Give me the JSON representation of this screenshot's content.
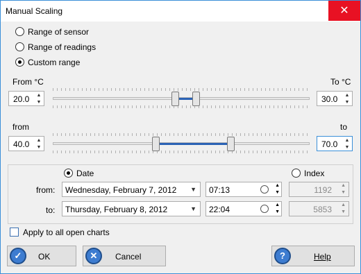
{
  "window": {
    "title": "Manual Scaling",
    "close_glyph": "✕"
  },
  "range_options": [
    {
      "label": "Range of sensor",
      "selected": false
    },
    {
      "label": "Range of readings",
      "selected": false
    },
    {
      "label": "Custom range",
      "selected": true
    }
  ],
  "temp_range": {
    "from_label": "From °C",
    "to_label": "To °C",
    "from_value": "20.0",
    "to_value": "30.0"
  },
  "reading_range": {
    "from_label": "from",
    "to_label": "to",
    "from_value": "40.0",
    "to_value": "70.0"
  },
  "selection": {
    "date_label": "Date",
    "date_selected": true,
    "index_label": "Index",
    "index_selected": false,
    "from_label": "from:",
    "to_label": "to:",
    "from_date": "Wednesday, February 7, 2012",
    "from_time": "07:13",
    "from_index": "1192",
    "to_date": "Thursday, February 8, 2012",
    "to_time": "22:04",
    "to_index": "5853"
  },
  "apply_all": {
    "label": "Apply to all open charts",
    "checked": false
  },
  "buttons": {
    "ok": "OK",
    "cancel": "Cancel",
    "help": "Help"
  },
  "icons": {
    "ok": "check-icon",
    "cancel": "x-icon",
    "help": "question-icon"
  }
}
